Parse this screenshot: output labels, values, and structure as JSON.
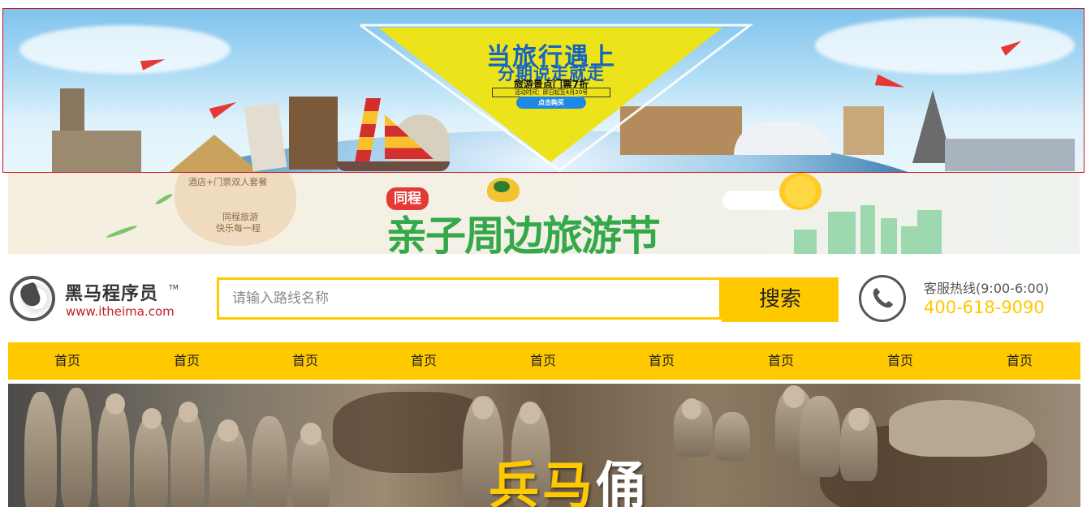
{
  "banner_top": {
    "headline_1": "当旅行遇上",
    "headline_2": "分期说走就走",
    "promo": "旅游景点门票7折",
    "date": "活动时间：即日起至4月20号",
    "buy_label": "点击购买"
  },
  "banner_second": {
    "bubble_line_1": "酒店+门票双人套餐",
    "bubble_line_2": "同程旅游",
    "bubble_line_3": "快乐每一程",
    "badge": "同程",
    "festival": "亲子周边旅游节"
  },
  "header": {
    "logo_name": "黑马程序员",
    "logo_tm": "TM",
    "logo_url": "www.itheima.com",
    "search": {
      "value": "",
      "placeholder": "请输入路线名称",
      "button_label": "搜索"
    },
    "hotline_label": "客服热线(9:00-6:00)",
    "hotline_number": "400-618-9090"
  },
  "nav": {
    "items": [
      "首页",
      "首页",
      "首页",
      "首页",
      "首页",
      "首页",
      "首页",
      "首页",
      "首页"
    ]
  },
  "hero": {
    "title_part1": "兵马",
    "title_part2": "俑"
  },
  "colors": {
    "accent": "#ffc900",
    "logo_url": "#c0202a",
    "banner_border": "#d0121b"
  }
}
